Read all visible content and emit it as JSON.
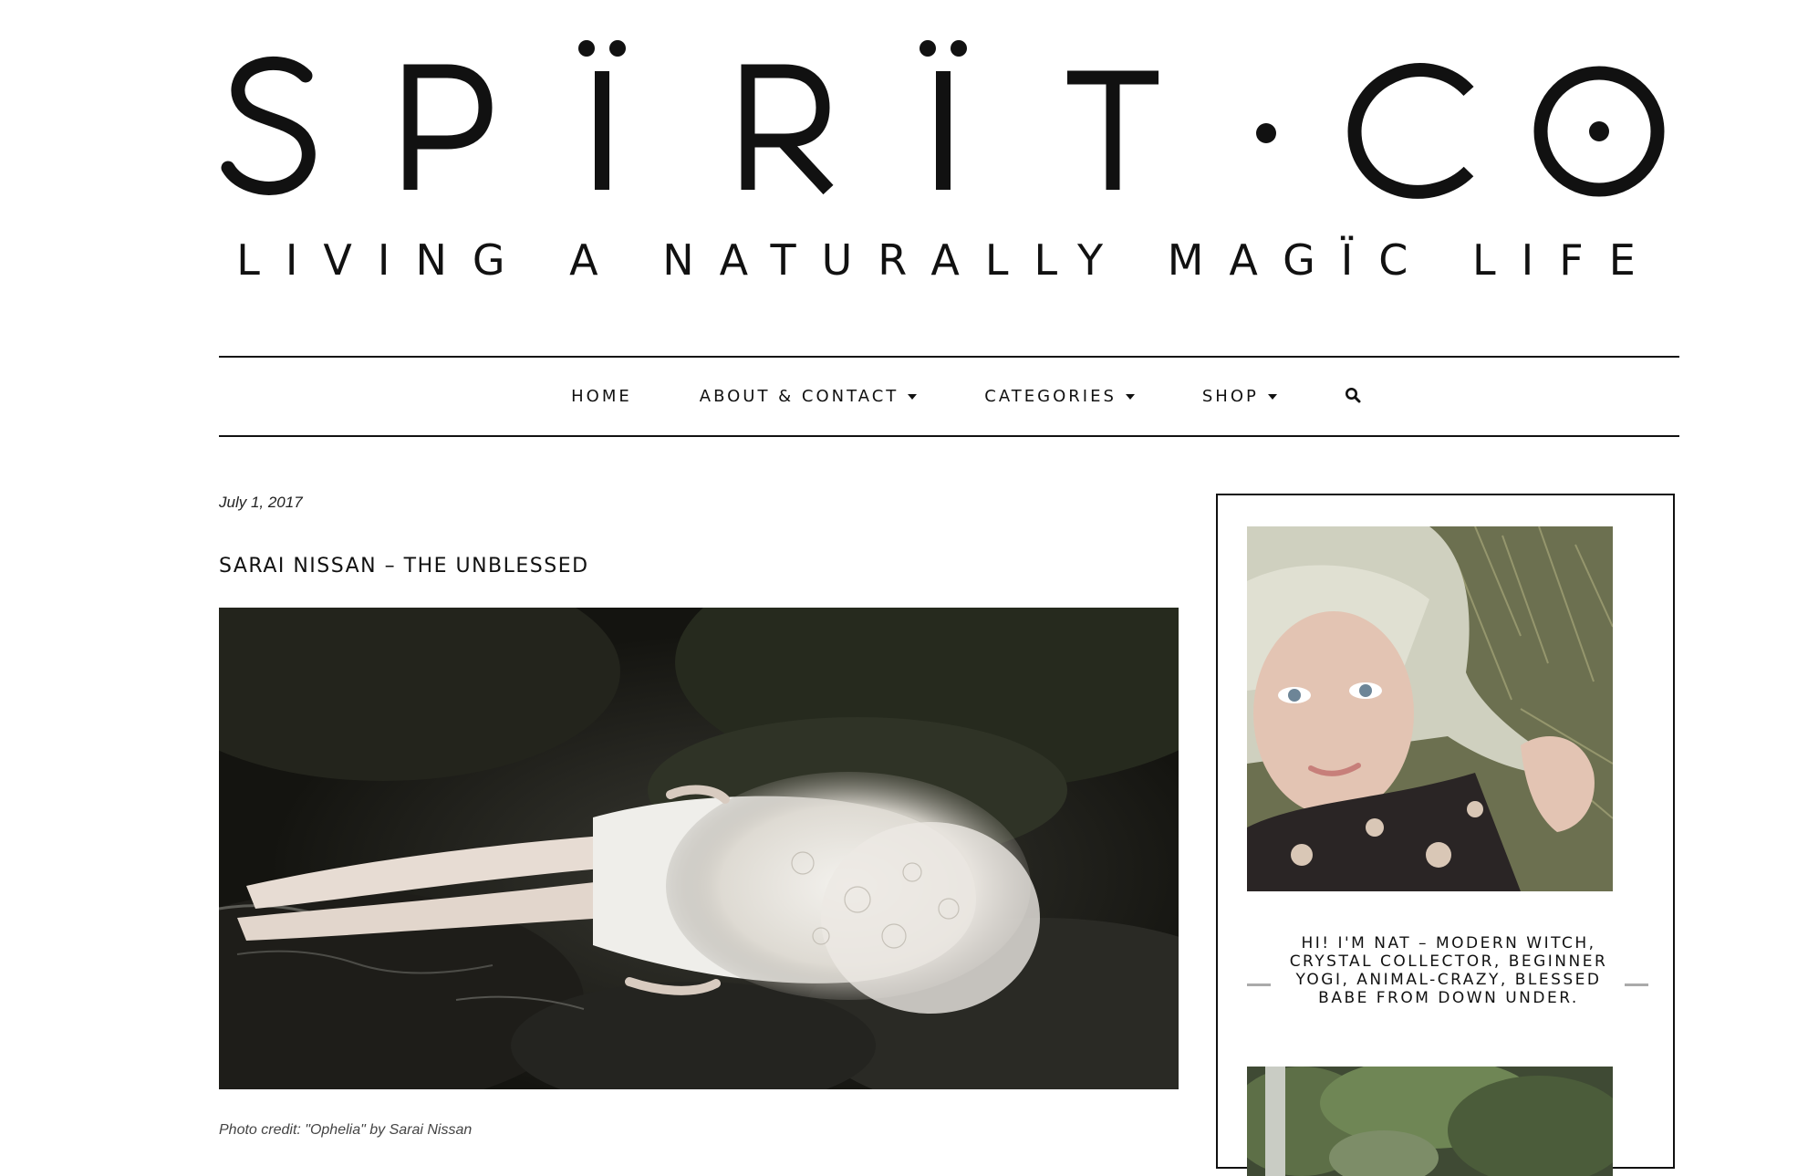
{
  "site": {
    "logo_text": "SPÏRÏT·CO",
    "tagline": "LIVING A NATURALLY MAGÏC LIFE"
  },
  "nav": {
    "items": [
      {
        "label": "HOME",
        "has_dropdown": false
      },
      {
        "label": "ABOUT & CONTACT",
        "has_dropdown": true
      },
      {
        "label": "CATEGORIES",
        "has_dropdown": true
      },
      {
        "label": "SHOP",
        "has_dropdown": true
      }
    ],
    "search_icon": "search-icon"
  },
  "post": {
    "date": "July 1, 2017",
    "title": "SARAI NISSAN – THE UNBLESSED",
    "photo_credit": "Photo credit: \"Ophelia\" by Sarai Nissan"
  },
  "sidebar": {
    "bio": "HI! I'M NAT – MODERN WITCH, CRYSTAL COLLECTOR, BEGINNER YOGI, ANIMAL-CRAZY, BLESSED BABE FROM DOWN UNDER."
  },
  "colors": {
    "text": "#111111",
    "background": "#ffffff",
    "rule": "#111111"
  }
}
